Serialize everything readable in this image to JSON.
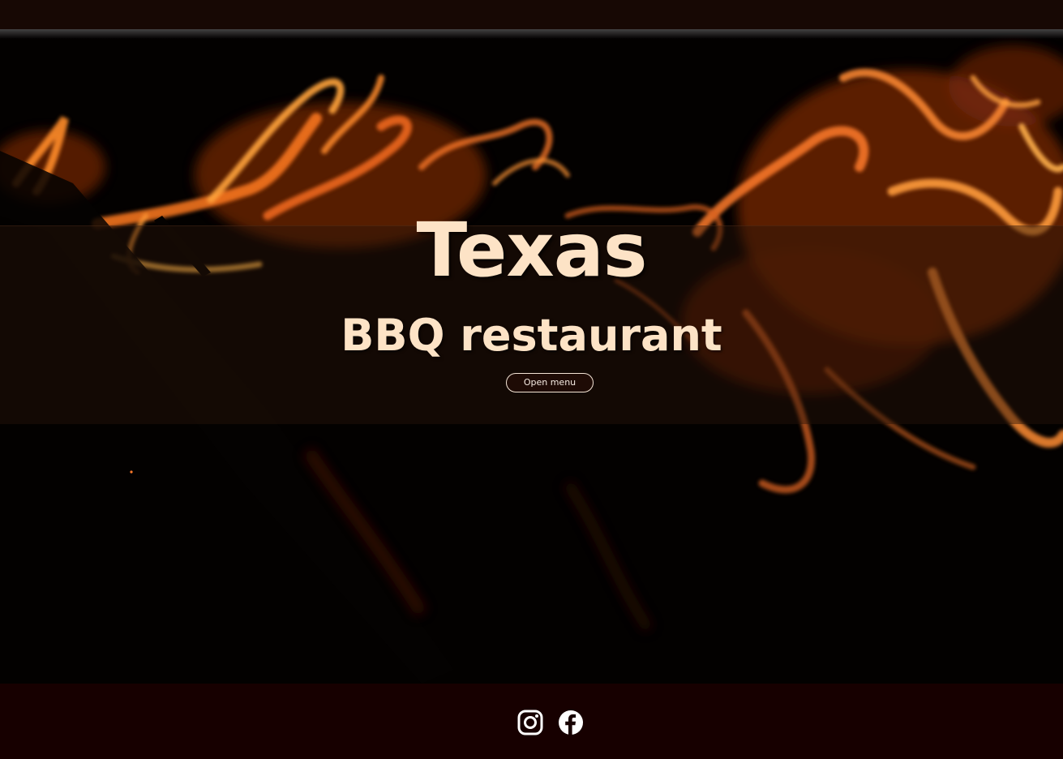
{
  "hero": {
    "title": "Texas",
    "subtitle": "BBQ restaurant",
    "menu_button_label": "Open menu"
  },
  "footer": {
    "social_icons": [
      "instagram-icon",
      "facebook-icon"
    ]
  },
  "colors": {
    "top_bar": "#170804",
    "footer": "#170000",
    "title_text": "#fde3c6",
    "button_border": "#f3e3d5"
  }
}
